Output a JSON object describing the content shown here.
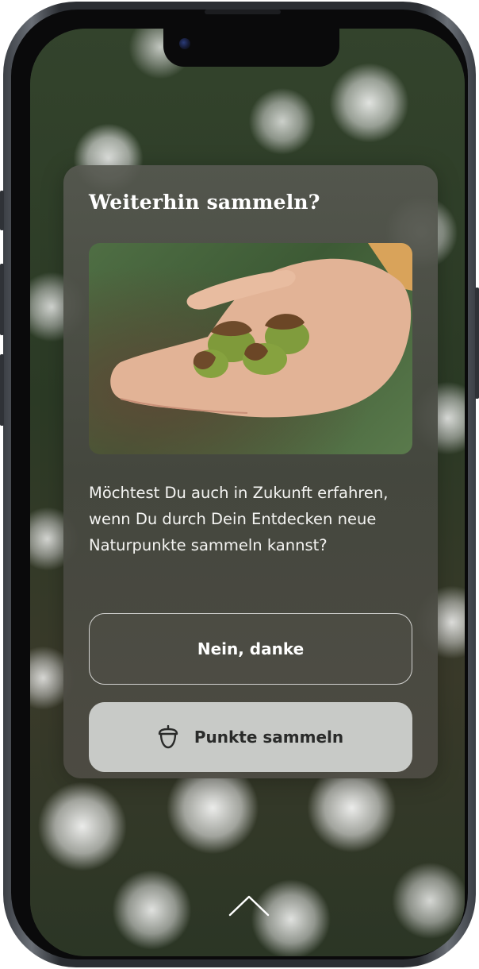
{
  "dialog": {
    "title": "Weiterhin sammeln?",
    "image_alt": "Hand mit Eicheln",
    "message": "Möchtest Du auch in Zukunft erfahren, wenn Du durch Dein Entdecken neue Naturpunkte sammeln kannst?",
    "decline_label": "Nein, danke",
    "accept_label": "Punkte sammeln",
    "accept_icon": "acorn-icon"
  },
  "navigation": {
    "swipe_icon": "chevron-up-icon"
  },
  "colors": {
    "card_background": "#4c4d45",
    "primary_button": "#c8cac7",
    "primary_button_text": "#2a2b2a",
    "text": "#ffffff"
  }
}
